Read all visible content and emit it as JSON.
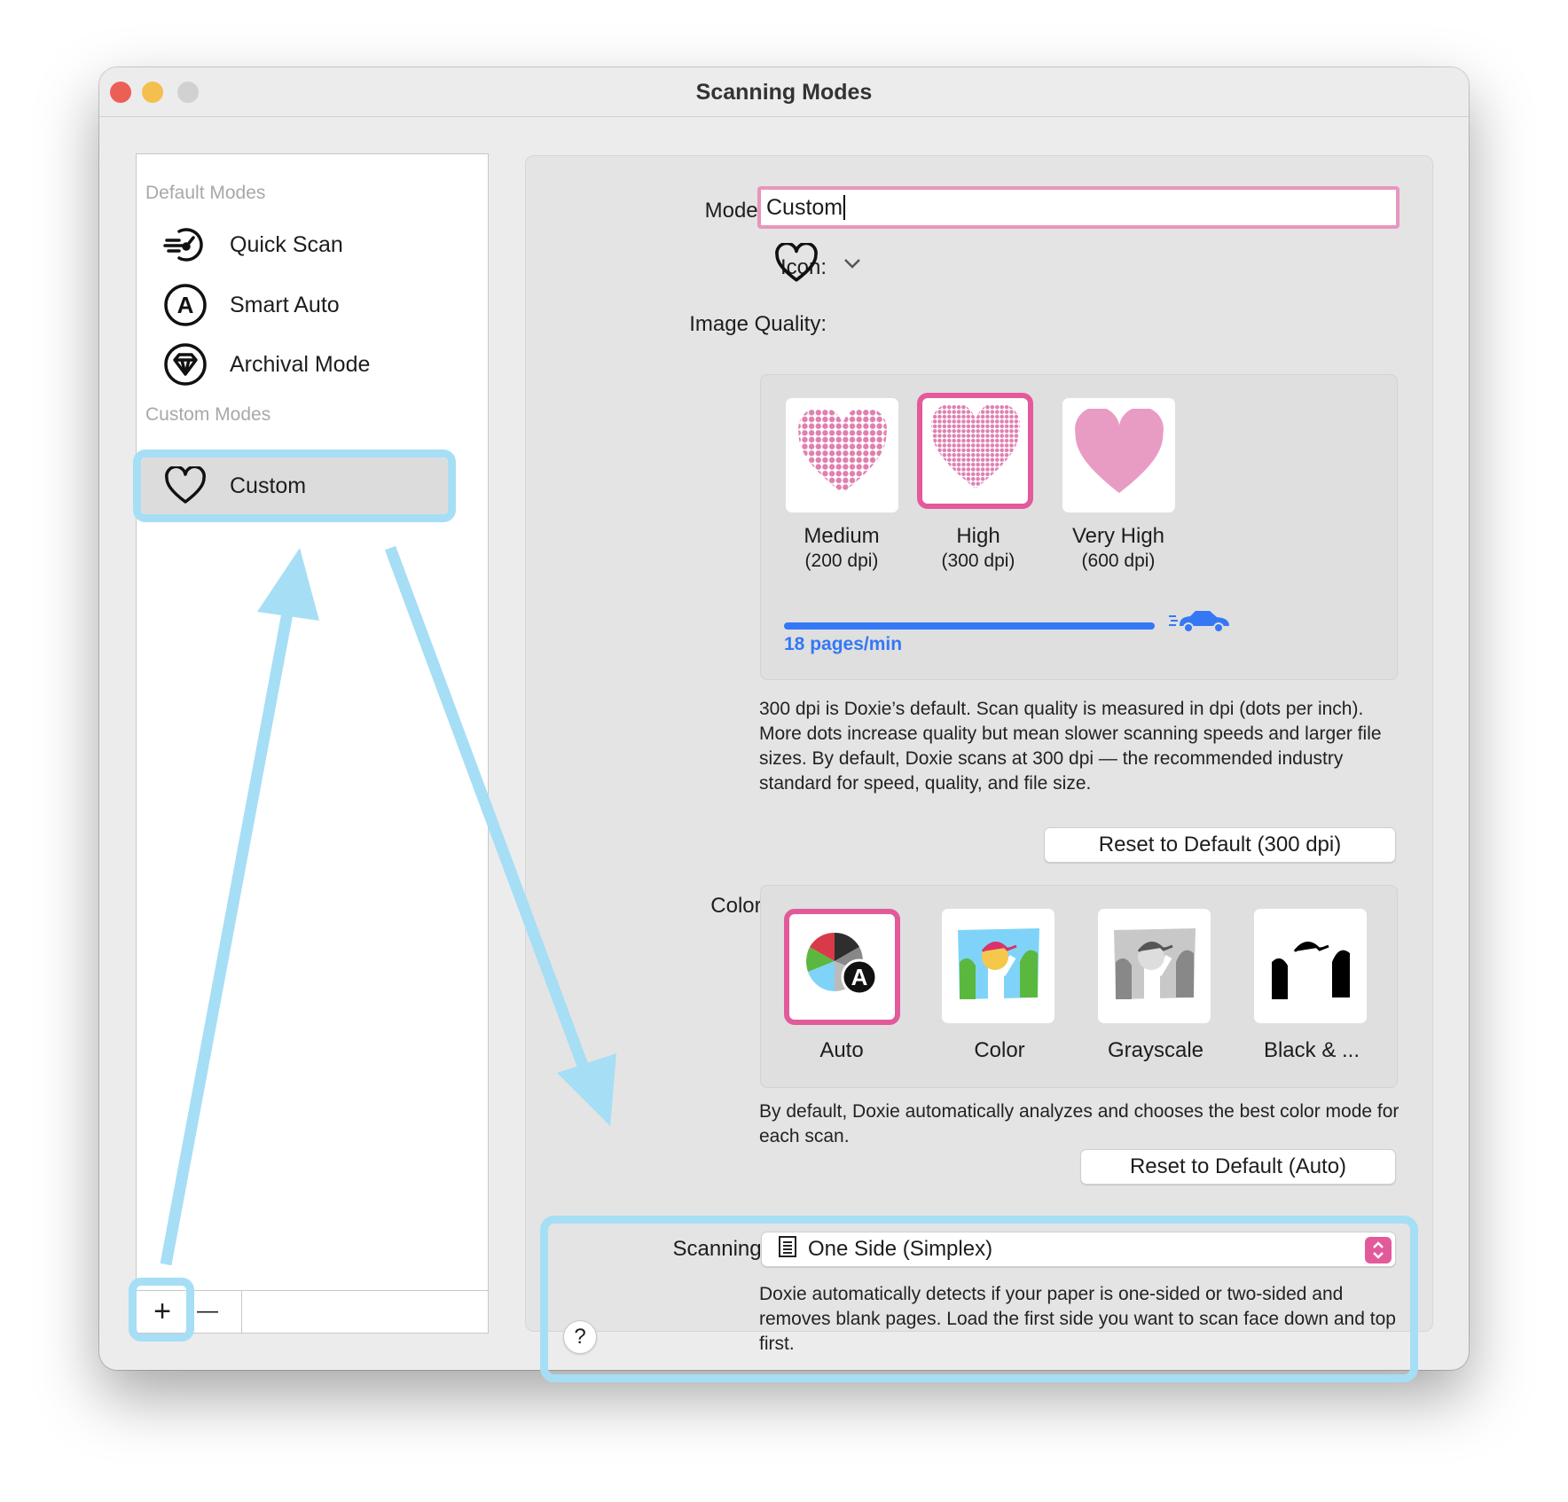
{
  "window": {
    "title": "Scanning Modes"
  },
  "sidebar": {
    "default_header": "Default Modes",
    "default_items": [
      {
        "label": "Quick Scan",
        "icon": "quick-scan-icon"
      },
      {
        "label": "Smart Auto",
        "icon": "smart-auto-icon"
      },
      {
        "label": "Archival Mode",
        "icon": "diamond-icon"
      }
    ],
    "custom_header": "Custom Modes",
    "custom_items": [
      {
        "label": "Custom",
        "icon": "heart-icon",
        "selected": true
      }
    ],
    "add_label": "+",
    "remove_label": "—"
  },
  "form": {
    "mode_name_label": "Mode Name:",
    "mode_name_value": "Custom",
    "icon_label": "Icon:",
    "icon_value": "heart-icon",
    "quality_label": "Image Quality:",
    "quality_options": [
      {
        "name": "Medium",
        "dpi": "(200 dpi)"
      },
      {
        "name": "High",
        "dpi": "(300 dpi)",
        "selected": true
      },
      {
        "name": "Very High",
        "dpi": "(600 dpi)"
      }
    ],
    "speed_text": "18 pages/min",
    "speed_fraction": 0.8,
    "quality_desc": "300 dpi is Doxie’s default. Scan quality is measured in dpi (dots per inch). More dots increase quality but mean slower scanning speeds and larger file sizes. By default, Doxie scans at 300 dpi — the recommended industry standard for speed, quality, and file size.",
    "quality_reset": "Reset to Default (300 dpi)",
    "color_label": "Color Mode:",
    "color_options": [
      {
        "name": "Auto",
        "selected": true
      },
      {
        "name": "Color"
      },
      {
        "name": "Grayscale"
      },
      {
        "name": "Black & ..."
      }
    ],
    "color_desc": "By default, Doxie automatically analyzes and chooses the best color mode for each scan.",
    "color_reset": "Reset to Default (Auto)",
    "sides_label": "Scanning Sides:",
    "sides_value": "One Side (Simplex)",
    "sides_desc": "Doxie automatically detects if your paper is one-sided or two-sided and removes blank pages. Load the first side you want to scan face down and top first.",
    "help_label": "?"
  },
  "colors": {
    "accent_pink": "#e35a9a",
    "highlight_cyan": "#a6def5",
    "speed_blue": "#3478f6"
  }
}
